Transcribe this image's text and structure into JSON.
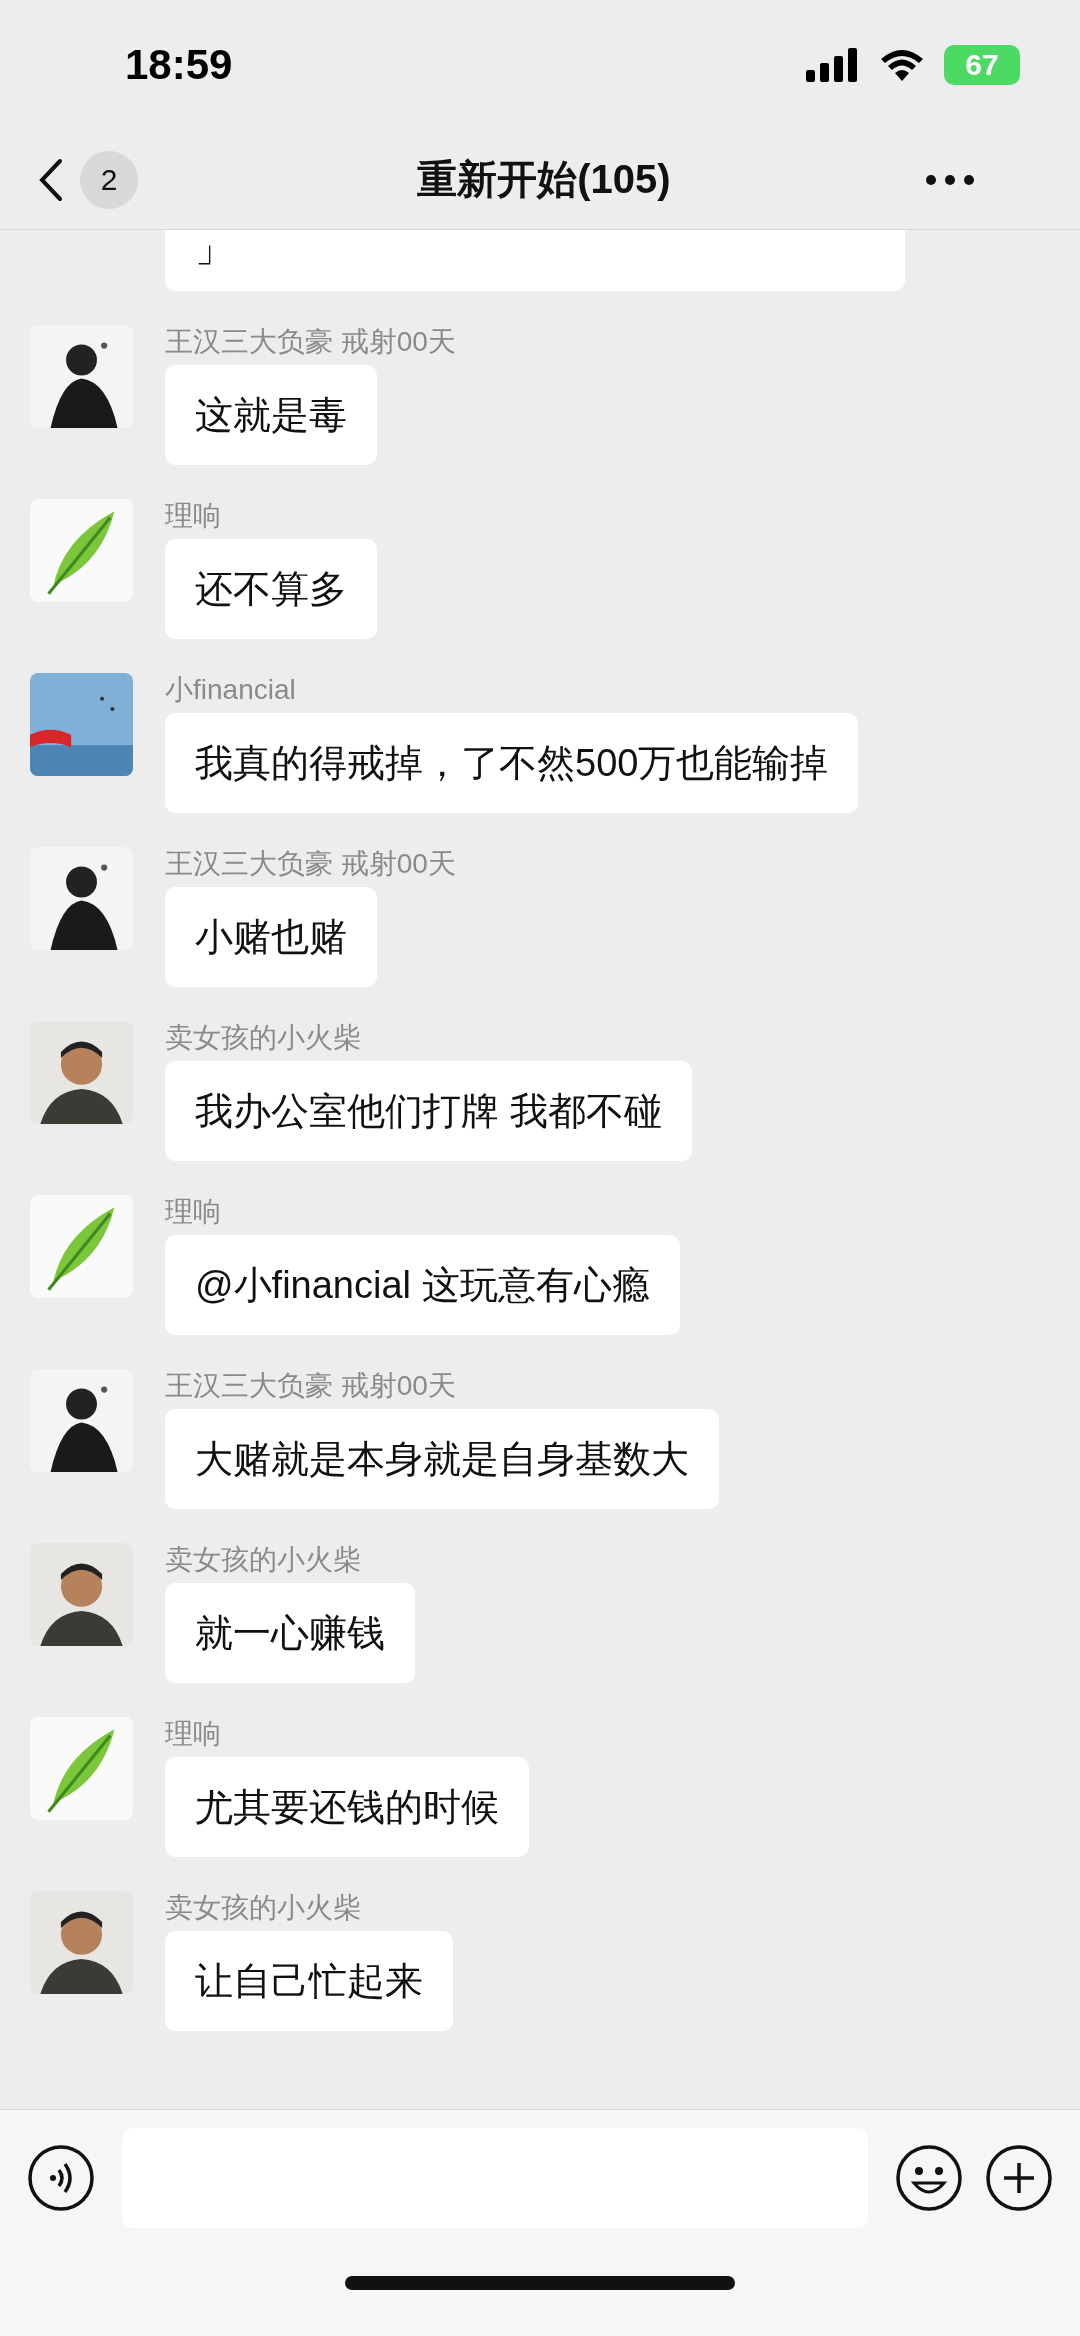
{
  "status_bar": {
    "time": "18:59",
    "battery": "67"
  },
  "nav": {
    "back_badge": "2",
    "title": "重新开始(105)"
  },
  "messages": [
    {
      "text": "」"
    },
    {
      "sender": "王汉三大负豪 戒射00天",
      "avatar": {
        "kind": "ink"
      },
      "text": "这就是毒"
    },
    {
      "sender": "理响",
      "avatar": {
        "kind": "feather"
      },
      "text": "还不算多"
    },
    {
      "sender": "小financial",
      "avatar": {
        "kind": "sky"
      },
      "text": "我真的得戒掉，了不然500万也能输掉"
    },
    {
      "sender": "王汉三大负豪 戒射00天",
      "avatar": {
        "kind": "ink"
      },
      "text": "小赌也赌"
    },
    {
      "sender": "卖女孩的小火柴",
      "avatar": {
        "kind": "man"
      },
      "text": "我办公室他们打牌 我都不碰"
    },
    {
      "sender": "理响",
      "avatar": {
        "kind": "feather"
      },
      "text": "@小financial 这玩意有心瘾"
    },
    {
      "sender": "王汉三大负豪 戒射00天",
      "avatar": {
        "kind": "ink"
      },
      "text": "大赌就是本身就是自身基数大"
    },
    {
      "sender": "卖女孩的小火柴",
      "avatar": {
        "kind": "man"
      },
      "text": "就一心赚钱"
    },
    {
      "sender": "理响",
      "avatar": {
        "kind": "feather"
      },
      "text": "尤其要还钱的时候"
    },
    {
      "sender": "卖女孩的小火柴",
      "avatar": {
        "kind": "man"
      },
      "text": "让自己忙起来"
    }
  ]
}
